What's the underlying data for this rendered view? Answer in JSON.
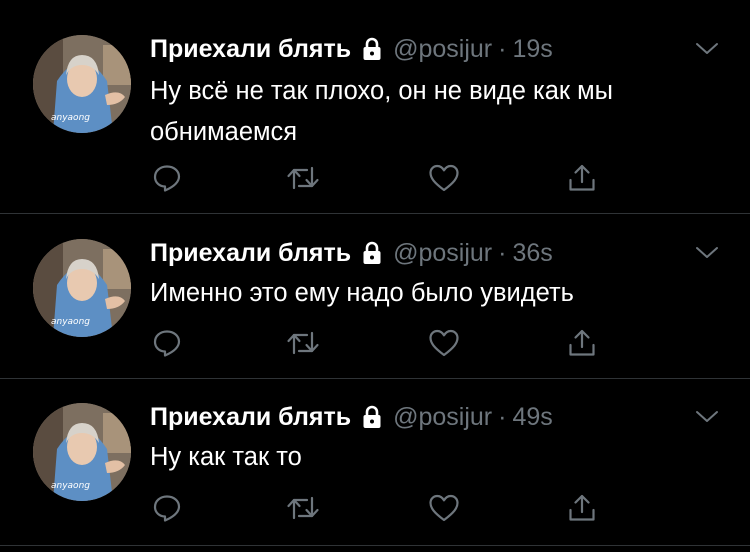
{
  "colors": {
    "background": "#000000",
    "text": "#ffffff",
    "secondary": "#6e767d",
    "divider": "#2f3336"
  },
  "tweets": [
    {
      "name": "Приехали блять",
      "handle": "@posijur",
      "separator": "·",
      "time": "19s",
      "text": "Ну всё не так плохо, он не виде как мы обнимаемся",
      "avatar_watermark": "anyaong",
      "icons": [
        "lock-icon",
        "chevron-down-icon",
        "reply-icon",
        "retweet-icon",
        "like-icon",
        "share-icon"
      ]
    },
    {
      "name": "Приехали блять",
      "handle": "@posijur",
      "separator": "·",
      "time": "36s",
      "text": "Именно это ему надо было увидеть",
      "avatar_watermark": "anyaong",
      "icons": [
        "lock-icon",
        "chevron-down-icon",
        "reply-icon",
        "retweet-icon",
        "like-icon",
        "share-icon"
      ]
    },
    {
      "name": "Приехали блять",
      "handle": "@posijur",
      "separator": "·",
      "time": "49s",
      "text": "Ну как так то",
      "avatar_watermark": "anyaong",
      "icons": [
        "lock-icon",
        "chevron-down-icon",
        "reply-icon",
        "retweet-icon",
        "like-icon",
        "share-icon"
      ]
    }
  ]
}
